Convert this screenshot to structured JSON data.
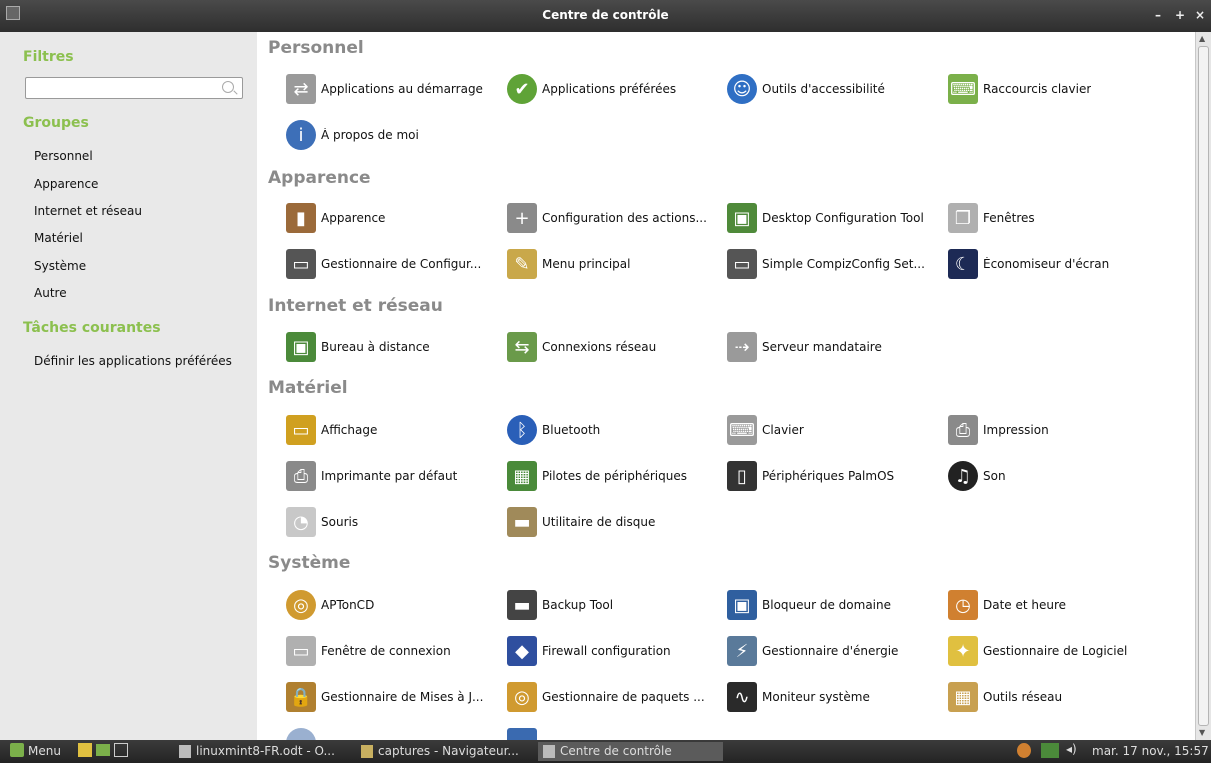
{
  "window": {
    "title": "Centre de contrôle",
    "controls": [
      "–",
      "+",
      "×"
    ]
  },
  "sidebar": {
    "filters_heading": "Filtres",
    "search_placeholder": "",
    "groups_heading": "Groupes",
    "groups": [
      "Personnel",
      "Apparence",
      "Internet et réseau",
      "Matériel",
      "Système",
      "Autre"
    ],
    "tasks_heading": "Tâches courantes",
    "tasks": [
      "Définir les applications préférées"
    ]
  },
  "main": {
    "categories": [
      {
        "name": "Personnel",
        "items": [
          "Applications au démarrage",
          "Applications préférées",
          "Outils d'accessibilité",
          "Raccourcis clavier",
          "À propos de moi"
        ]
      },
      {
        "name": "Apparence",
        "items": [
          "Apparence",
          "Configuration des actions...",
          "Desktop Configuration Tool",
          "Fenêtres",
          "Gestionnaire de Configur...",
          "Menu principal",
          "Simple CompizConfig Set...",
          "Économiseur d'écran"
        ]
      },
      {
        "name": "Internet et réseau",
        "items": [
          "Bureau à distance",
          "Connexions réseau",
          "Serveur mandataire"
        ]
      },
      {
        "name": "Matériel",
        "items": [
          "Affichage",
          "Bluetooth",
          "Clavier",
          "Impression",
          "Imprimante par défaut",
          "Pilotes de périphériques",
          "Périphériques PalmOS",
          "Son",
          "Souris",
          "Utilitaire de disque"
        ]
      },
      {
        "name": "Système",
        "items": [
          "APTonCD",
          "Backup Tool",
          "Bloqueur de domaine",
          "Date et heure",
          "Fenêtre de connexion",
          "Firewall configuration",
          "Gestionnaire d'énergie",
          "Gestionnaire de Logiciel",
          "Gestionnaire de Mises à J...",
          "Gestionnaire de paquets ...",
          "Moniteur système",
          "Outils réseau"
        ]
      }
    ]
  },
  "taskbar": {
    "menu_label": "Menu",
    "tasks": [
      "linuxmint8-FR.odt - O...",
      "captures - Navigateur...",
      "Centre de contrôle"
    ],
    "clock": "mar. 17 nov., 15:57"
  },
  "colors": {
    "accent": "#8cc04f",
    "category": "#8a8a8a"
  }
}
